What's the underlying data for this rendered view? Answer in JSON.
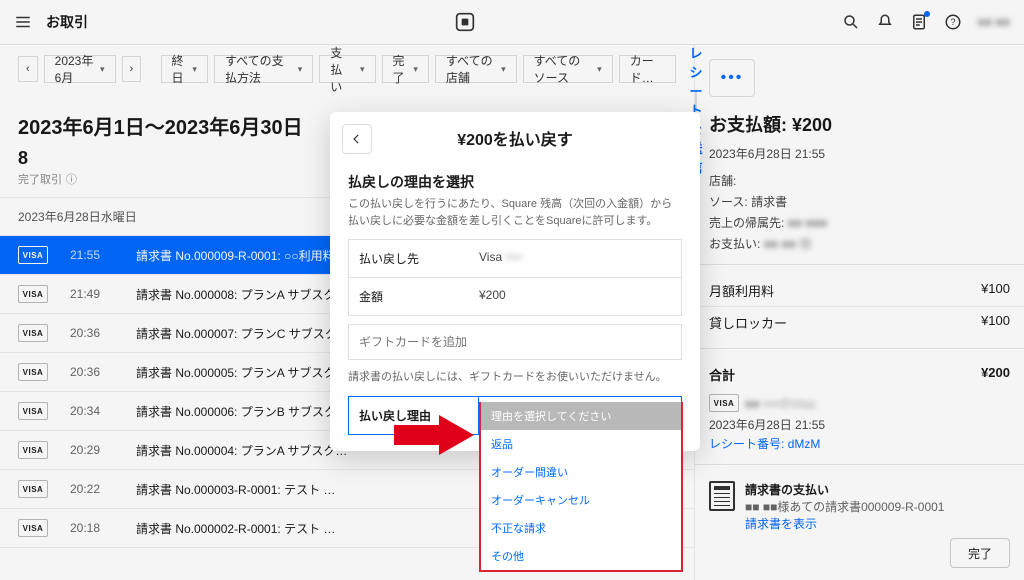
{
  "topbar": {
    "title": "お取引",
    "user_blur": "■■ ■■"
  },
  "filters": {
    "range_pill": "2023年6月",
    "pills": [
      "終日",
      "すべての支払方法",
      "支払い",
      "完了",
      "すべての店舗",
      "すべてのソース",
      "カード…"
    ]
  },
  "range_heading": "2023年6月1日〜2023年6月30日",
  "count": "8",
  "count_sub": "完了取引",
  "day_header": "2023年6月28日水曜日",
  "rows": [
    {
      "card": "VISA",
      "time": "21:55",
      "desc": "請求書 No.000009-R-0001: ○○利用料",
      "selected": true
    },
    {
      "card": "VISA",
      "time": "21:49",
      "desc": "請求書 No.000008: プランA サブスク…"
    },
    {
      "card": "VISA",
      "time": "20:36",
      "desc": "請求書 No.000007: プランC サブスク…"
    },
    {
      "card": "VISA",
      "time": "20:36",
      "desc": "請求書 No.000005: プランA サブスク…"
    },
    {
      "card": "VISA",
      "time": "20:34",
      "desc": "請求書 No.000006: プランB サブスク…"
    },
    {
      "card": "VISA",
      "time": "20:29",
      "desc": "請求書 No.000004: プランA サブスク…"
    },
    {
      "card": "VISA",
      "time": "20:22",
      "desc": "請求書 No.000003-R-0001: テスト …"
    },
    {
      "card": "VISA",
      "time": "20:18",
      "desc": "請求書 No.000002-R-0001: テスト …"
    }
  ],
  "side": {
    "send_receipt": "レシートを送信",
    "title": "お支払額: ¥200",
    "datetime": "2023年6月28日 21:55",
    "store_label": "店舗:",
    "source_label": "ソース:",
    "source_value": "請求書",
    "ownership_label": "売上の帰属先:",
    "ownership_value": "■■ ■■■",
    "paid_label": "お支払い:",
    "paid_value": "■■ ■■ 様",
    "items": [
      {
        "name": "月額利用料",
        "price": "¥100"
      },
      {
        "name": "貸しロッカー",
        "price": "¥100"
      }
    ],
    "total_label": "合計",
    "total_value": "¥200",
    "card_masked": "■■ ••••のVisa",
    "card_dt": "2023年6月28日 21:55",
    "receipt_no_label": "レシート番号:",
    "receipt_no": "dMzM",
    "invoice_title": "請求書の支払い",
    "invoice_desc": "■■ ■■様あての請求書000009-R-0001",
    "invoice_link": "請求書を表示",
    "done": "完了"
  },
  "dialog": {
    "title": "¥200を払い戻す",
    "section": "払戻しの理由を選択",
    "note": "この払い戻しを行うにあたり、Square 残高（次回の入金額）から払い戻しに必要な金額を差し引くことをSquareに許可します。",
    "refund_to_label": "払い戻し先",
    "refund_to_value": "Visa",
    "refund_to_masked": "••••",
    "amount_label": "金額",
    "amount_value": "¥200",
    "gift_placeholder": "ギフトカードを追加",
    "gift_note": "請求書の払い戻しには、ギフトカードをお使いいただけません。",
    "reason_label": "払い戻し理由",
    "reason_placeholder": "理由を選択してください",
    "options": [
      "理由を選択してください",
      "返品",
      "オーダー間違い",
      "オーダーキャンセル",
      "不正な請求",
      "その他"
    ]
  }
}
